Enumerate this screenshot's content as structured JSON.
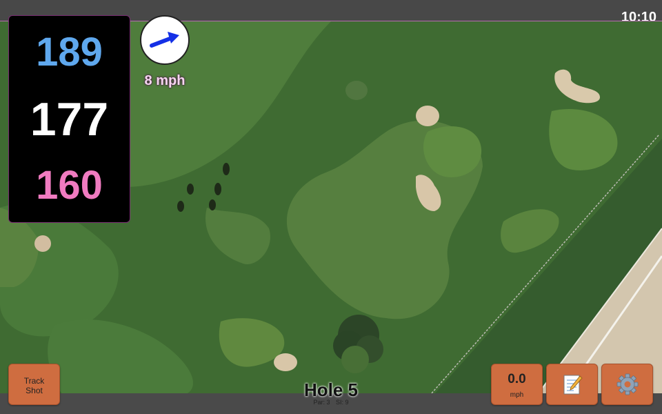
{
  "status": {
    "time": "10:10"
  },
  "distances": {
    "back": "189",
    "middle": "177",
    "front": "160"
  },
  "wind": {
    "speed": "8 mph",
    "direction_icon": "wind-arrow-icon"
  },
  "hole": {
    "title": "Hole 5",
    "par": "Par: 3",
    "stroke_index": "SI: 9"
  },
  "buttons": {
    "track_shot": {
      "line1": "Track",
      "line2": "Shot"
    },
    "speed": {
      "value": "0.0",
      "unit": "mph"
    },
    "notes_icon": "notepad-icon",
    "settings_icon": "gear-icon"
  },
  "colors": {
    "back_distance": "#5fa8ee",
    "middle_distance": "#ffffff",
    "front_distance": "#f07bc0",
    "button": "#cf6d40",
    "wind_arrow": "#1430e6"
  }
}
